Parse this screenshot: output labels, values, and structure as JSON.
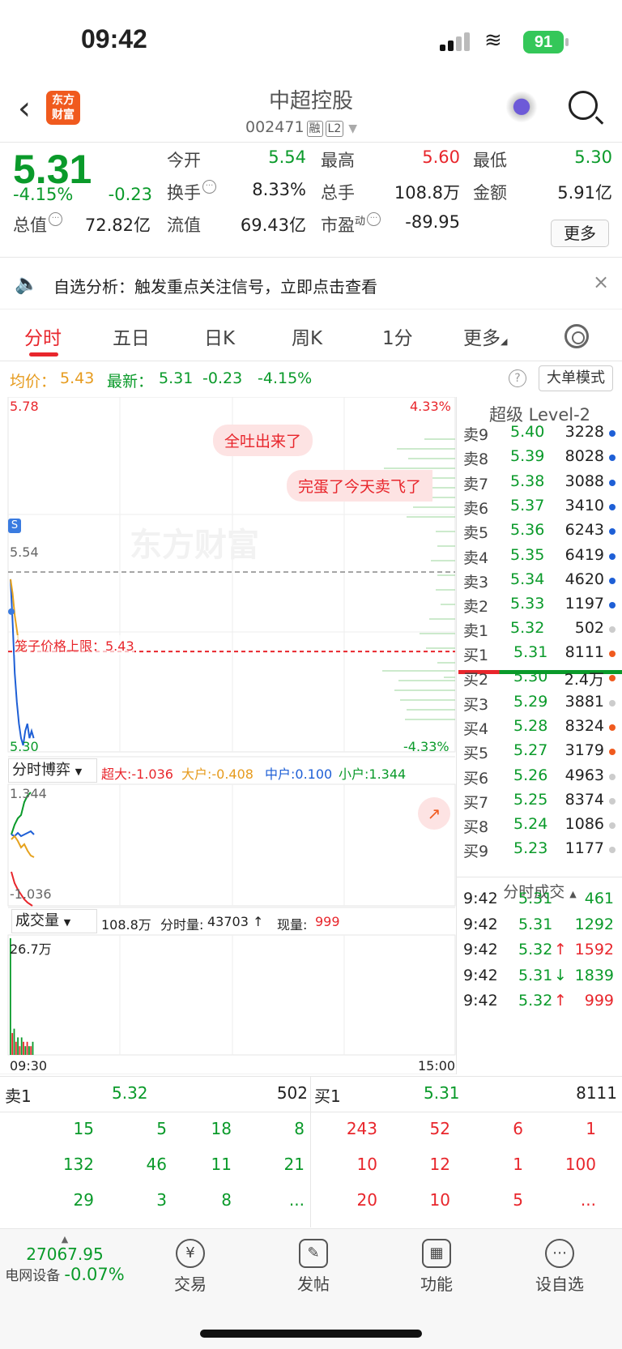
{
  "status_bar": {
    "time": "09:42",
    "battery": "91"
  },
  "header": {
    "logo_text_1": "东方",
    "logo_text_2": "财富",
    "stock_name": "中超控股",
    "stock_code": "002471",
    "tag_margin": "融",
    "tag_level": "L2"
  },
  "quote": {
    "price": "5.31",
    "change_pct": "-4.15%",
    "change": "-0.23",
    "open_label": "今开",
    "open": "5.54",
    "high_label": "最高",
    "high": "5.60",
    "low_label": "最低",
    "low": "5.30",
    "turnover_label": "换手",
    "turnover": "8.33%",
    "volume_label": "总手",
    "volume": "108.8万",
    "amount_label": "金额",
    "amount": "5.91亿",
    "mcap_label": "总值",
    "mcap": "72.82亿",
    "float_label": "流值",
    "float": "69.43亿",
    "pe_label": "市盈",
    "pe_sup": "动",
    "pe": "-89.95",
    "more": "更多"
  },
  "banner": {
    "text": "自选分析：触发重点关注信号，立即点击查看"
  },
  "tabs": [
    "分时",
    "五日",
    "日K",
    "周K",
    "1分",
    "更多"
  ],
  "avg_row": {
    "avg_label": "均价：",
    "avg": "5.43",
    "latest_label": "最新：",
    "latest": "5.31",
    "change": "-0.23",
    "change_pct": "-4.15%",
    "mode": "大单模式"
  },
  "chart": {
    "y_top": "5.78",
    "y_open": "5.54",
    "y_bottom": "5.30",
    "pct_top": "4.33%",
    "pct_bottom": "-4.33%",
    "limit_label": "笼子价格上限：5.43",
    "bubble1": "全吐出来了",
    "bubble2": "完蛋了今天卖飞了",
    "s_marker": "S",
    "watermark": "东方财富",
    "game_label": "分时博弈",
    "game_super": "超大:-1.036",
    "game_big": "大户:-0.408",
    "game_mid": "中户:0.100",
    "game_small": "小户:1.344",
    "game_top": "1.344",
    "game_bottom": "-1.036",
    "vol_label": "成交量",
    "vol_total": "108.8万",
    "vol_tick_label": "分时量:",
    "vol_tick": "43703",
    "vol_now_label": "现量:",
    "vol_now": "999",
    "vol_max": "26.7万",
    "time_start": "09:30",
    "time_end": "15:00"
  },
  "chart_data": {
    "type": "line",
    "series": [
      {
        "name": "最新",
        "values": [
          5.53,
          5.47,
          5.4,
          5.36,
          5.33,
          5.31,
          5.3,
          5.32,
          5.33,
          5.31,
          5.32,
          5.31
        ]
      },
      {
        "name": "均价",
        "values": [
          5.53,
          5.51,
          5.48,
          5.46,
          5.44,
          5.43
        ]
      }
    ],
    "ylim": [
      5.3,
      5.78
    ],
    "ref_line": 5.54,
    "limit_line": 5.43,
    "volume_bars": [
      26.7,
      5,
      6,
      3,
      4,
      2,
      4,
      3,
      2,
      3,
      2,
      2,
      3
    ]
  },
  "orderbook": {
    "title": "超级 Level-2",
    "asks": [
      {
        "label": "卖9",
        "price": "5.40",
        "vol": "3228"
      },
      {
        "label": "卖8",
        "price": "5.39",
        "vol": "8028"
      },
      {
        "label": "卖7",
        "price": "5.38",
        "vol": "3088"
      },
      {
        "label": "卖6",
        "price": "5.37",
        "vol": "3410"
      },
      {
        "label": "卖5",
        "price": "5.36",
        "vol": "6243"
      },
      {
        "label": "卖4",
        "price": "5.35",
        "vol": "6419"
      },
      {
        "label": "卖3",
        "price": "5.34",
        "vol": "4620"
      },
      {
        "label": "卖2",
        "price": "5.33",
        "vol": "1197"
      },
      {
        "label": "卖1",
        "price": "5.32",
        "vol": "502"
      }
    ],
    "bids": [
      {
        "label": "买1",
        "price": "5.31",
        "vol": "8111"
      },
      {
        "label": "买2",
        "price": "5.30",
        "vol": "2.4万"
      },
      {
        "label": "买3",
        "price": "5.29",
        "vol": "3881"
      },
      {
        "label": "买4",
        "price": "5.28",
        "vol": "8324"
      },
      {
        "label": "买5",
        "price": "5.27",
        "vol": "3179"
      },
      {
        "label": "买6",
        "price": "5.26",
        "vol": "4963"
      },
      {
        "label": "买7",
        "price": "5.25",
        "vol": "8374"
      },
      {
        "label": "买8",
        "price": "5.24",
        "vol": "1086"
      },
      {
        "label": "买9",
        "price": "5.23",
        "vol": "1177"
      }
    ],
    "trades_title": "分时成交",
    "trades": [
      {
        "time": "9:42",
        "price": "5.31",
        "arrow": "",
        "vol": "461"
      },
      {
        "time": "9:42",
        "price": "5.31",
        "arrow": "",
        "vol": "1292"
      },
      {
        "time": "9:42",
        "price": "5.32",
        "arrow": "↑",
        "vol": "1592"
      },
      {
        "time": "9:42",
        "price": "5.31",
        "arrow": "↓",
        "vol": "1839"
      },
      {
        "time": "9:42",
        "price": "5.32",
        "arrow": "↑",
        "vol": "999"
      }
    ]
  },
  "queue": {
    "ask_label": "卖1",
    "ask_price": "5.32",
    "ask_vol": "502",
    "bid_label": "买1",
    "bid_price": "5.31",
    "bid_vol": "8111",
    "ask_rows": [
      [
        "15",
        "5",
        "18",
        "8"
      ],
      [
        "132",
        "46",
        "11",
        "21"
      ],
      [
        "29",
        "3",
        "8",
        "..."
      ]
    ],
    "bid_rows": [
      [
        "243",
        "52",
        "6",
        "1"
      ],
      [
        "10",
        "12",
        "1",
        "100"
      ],
      [
        "20",
        "10",
        "5",
        "..."
      ]
    ]
  },
  "toolbar": {
    "index_value": "27067.95",
    "index_name": "电网设备",
    "index_change": "-0.07%",
    "trade": "交易",
    "post": "发帖",
    "func": "功能",
    "watch": "设自选"
  }
}
